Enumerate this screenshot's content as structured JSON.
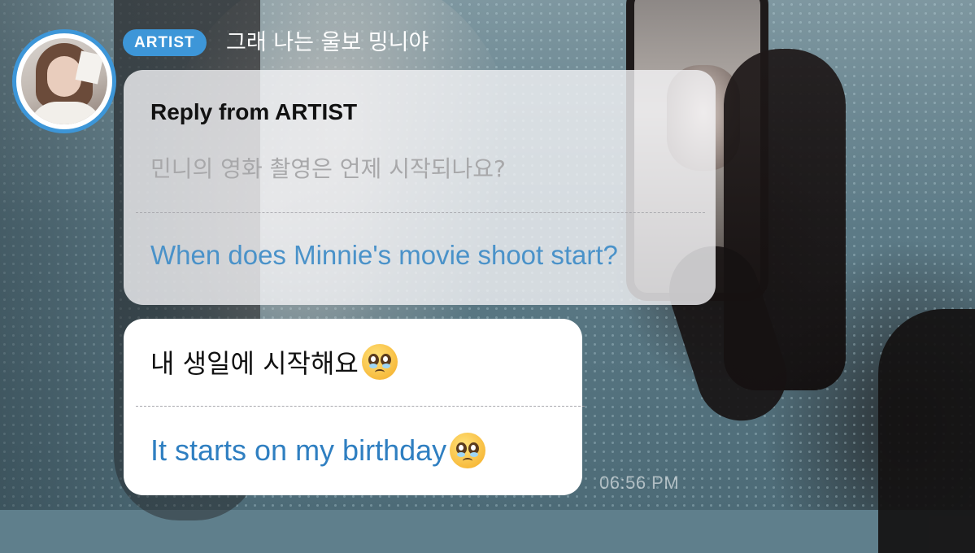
{
  "header": {
    "badge": "ARTIST",
    "display_name": "그래 나는 울보 밍니야"
  },
  "reply": {
    "title": "Reply from ARTIST",
    "question": "민니의 영화 촬영은 언제 시작되나요?",
    "translation": "When does Minnie's movie shoot start?"
  },
  "answer": {
    "text": "내 생일에 시작해요",
    "translation": "It starts on my birthday",
    "emoji": "pleading-face-emoji"
  },
  "timestamp": "06:56 PM",
  "colors": {
    "accent": "#3d96d8",
    "translation": "#4a92c9",
    "bubble": "#ffffff"
  }
}
